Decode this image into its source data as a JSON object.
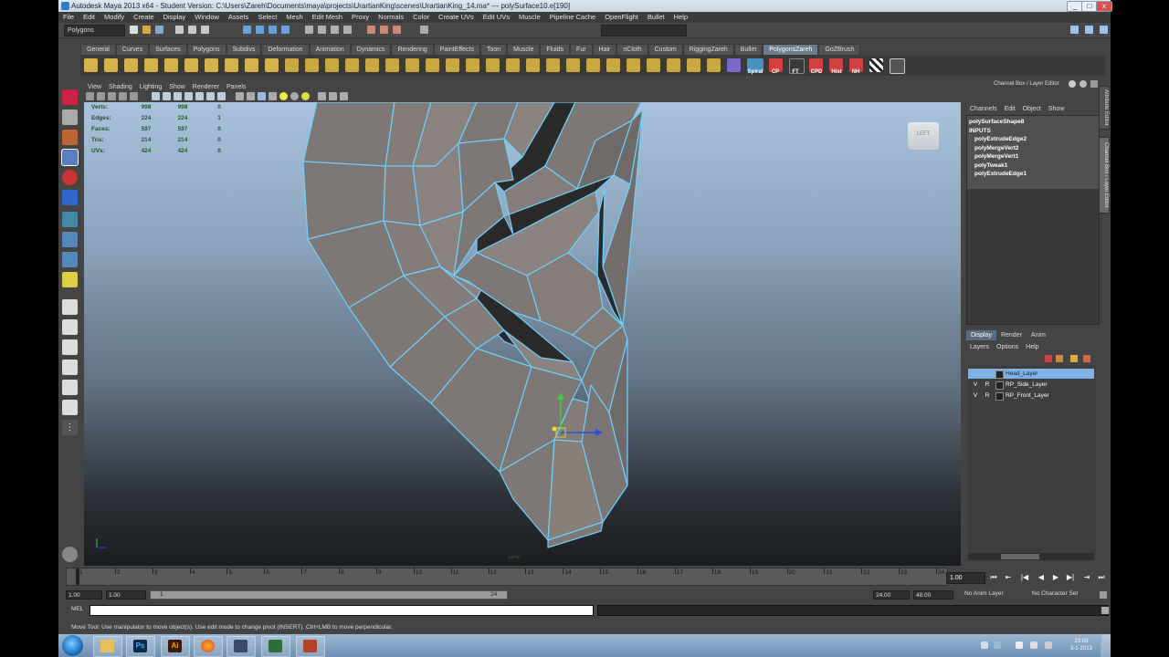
{
  "window": {
    "title": "Autodesk Maya 2013 x64 - Student Version: C:\\Users\\Zareh\\Documents\\maya\\projects\\UrartianKing\\scenes\\UrartianKing_14.ma*   ---   polySurface10.e[190]",
    "minimize": "_",
    "maximize": "□",
    "close": "x"
  },
  "menubar": [
    "File",
    "Edit",
    "Modify",
    "Create",
    "Display",
    "Window",
    "Assets",
    "Select",
    "Mesh",
    "Edit Mesh",
    "Proxy",
    "Normals",
    "Color",
    "Create UVs",
    "Edit UVs",
    "Muscle",
    "Pipeline Cache",
    "OpenFlight",
    "Bullet",
    "Help"
  ],
  "status_line": {
    "mode": "Polygons"
  },
  "shelf_tabs": [
    "General",
    "Curves",
    "Surfaces",
    "Polygons",
    "Subdivs",
    "Deformation",
    "Animation",
    "Dynamics",
    "Rendering",
    "PaintEffects",
    "Toon",
    "Muscle",
    "Fluids",
    "Fur",
    "Hair",
    "nCloth",
    "Custom",
    "RiggingZareh",
    "Bullet",
    "PolygonsZareh",
    "GoZBrush"
  ],
  "shelf_active": "PolygonsZareh",
  "shelf_labels": [
    "Spiral",
    "CP",
    "FT",
    "CPD",
    "Hist",
    "NH"
  ],
  "viewport": {
    "menu": [
      "View",
      "Shading",
      "Lighting",
      "Show",
      "Renderer",
      "Panels"
    ],
    "hud": [
      {
        "label": "Verts:",
        "a": "998",
        "b": "998",
        "c": "0"
      },
      {
        "label": "Edges:",
        "a": "224",
        "b": "224",
        "c": "1"
      },
      {
        "label": "Faces:",
        "a": "597",
        "b": "597",
        "c": "0"
      },
      {
        "label": "Tris:",
        "a": "214",
        "b": "214",
        "c": "0"
      },
      {
        "label": "UVs:",
        "a": "424",
        "b": "424",
        "c": "0"
      }
    ],
    "viewcube": "LEFT",
    "camera_label": "persp"
  },
  "channel_box": {
    "title": "Channel Box / Layer Editor",
    "menu": [
      "Channels",
      "Edit",
      "Object",
      "Show"
    ],
    "object": "polySurfaceShape8",
    "inputs_header": "INPUTS",
    "inputs": [
      "polyExtrudeEdge2",
      "polyMergeVert2",
      "polyMergeVert1",
      "polyTweak1",
      "polyExtrudeEdge1"
    ],
    "side_tabs": [
      "Attribute Editor",
      "Channel Box / Layer Editor"
    ]
  },
  "layer_editor": {
    "tabs": [
      "Display",
      "Render",
      "Anim"
    ],
    "active_tab": "Display",
    "menu": [
      "Layers",
      "Options",
      "Help"
    ],
    "layers": [
      {
        "v": "",
        "r": "",
        "name": "Head_Layer",
        "selected": true
      },
      {
        "v": "V",
        "r": "R",
        "name": "RP_Side_Layer",
        "selected": false
      },
      {
        "v": "V",
        "r": "R",
        "name": "RP_Front_Layer",
        "selected": false
      }
    ]
  },
  "time_slider": {
    "ticks": [
      "1",
      "2",
      "3",
      "4",
      "5",
      "6",
      "7",
      "8",
      "9",
      "10",
      "11",
      "12",
      "13",
      "14",
      "15",
      "16",
      "17",
      "18",
      "19",
      "20",
      "21",
      "22",
      "23",
      "24"
    ],
    "current_time": "1.00"
  },
  "range_slider": {
    "start": "1.00",
    "range_start": "1.00",
    "range_start_marker": "1",
    "range_end_marker": "24",
    "range_end": "24.00",
    "end": "48.00",
    "anim_layer": "No Anim Layer",
    "char_set": "No Character Set"
  },
  "mel": {
    "label": "MEL"
  },
  "help_line": "Move Tool: Use manipulator to move object(s). Use edit mode to change pivot (INSERT). Ctrl+LMB to move perpendicular.",
  "taskbar": {
    "apps": [
      "Ps",
      "Ai"
    ],
    "clock_time": "23:09",
    "clock_date": "3-1-2013"
  },
  "colors": {
    "selection": "#7fb0e6",
    "viewport_top": "#a8c3dd",
    "viewport_bottom": "#1a1c1f",
    "mesh": "#7d7775",
    "mesh_edge": "#6fd0ff"
  }
}
